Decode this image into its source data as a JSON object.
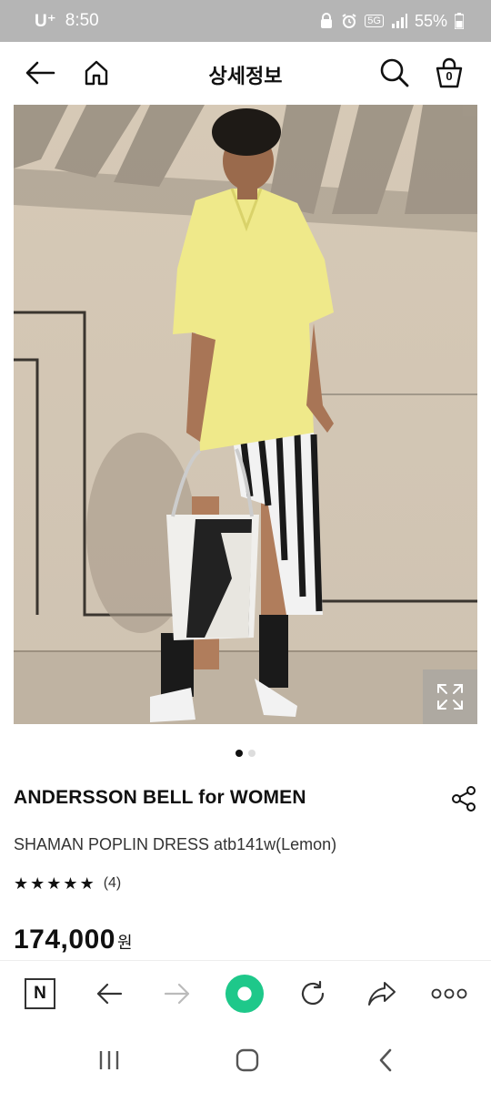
{
  "status": {
    "carrier": "U⁺",
    "time": "8:50",
    "network": "5G",
    "battery": "55%"
  },
  "header": {
    "title": "상세정보",
    "cart_count": "0",
    "icons": [
      "back-arrow-icon",
      "home-icon",
      "search-icon",
      "shopping-bag-icon"
    ]
  },
  "gallery": {
    "active_index": 0,
    "total": 2
  },
  "product": {
    "brand": "ANDERSSON BELL for WOMEN",
    "name": "SHAMAN POPLIN DRESS atb141w(Lemon)",
    "rating": 5,
    "review_count": "(4)",
    "price": "174,000",
    "currency": "원"
  },
  "browser_toolbar": {
    "n_button": "N",
    "icons": [
      "n-logo-icon",
      "back-arrow-icon",
      "forward-arrow-icon",
      "green-dot-icon",
      "reload-icon",
      "share-arrow-icon",
      "more-dots-icon"
    ]
  },
  "colors": {
    "status_bar": "#b5b5b5",
    "green_accent": "#1ec88a",
    "hero_shirt": "#efe98a"
  }
}
